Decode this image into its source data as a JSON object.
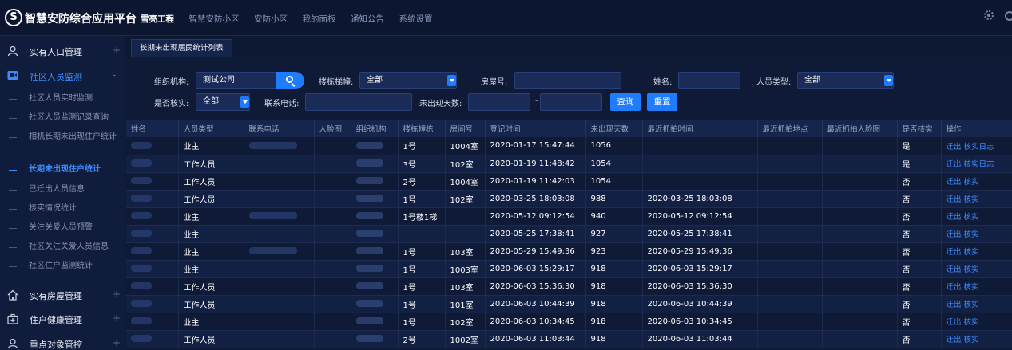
{
  "app": {
    "logo_glyph": "S",
    "title": "智慧安防综合应用平台"
  },
  "topnav": [
    "雪亮工程",
    "智慧安防小区",
    "安防小区",
    "我的面板",
    "通知公告",
    "系统设置"
  ],
  "sidebar": {
    "groups": [
      {
        "label": "实有人口管理",
        "toggle": "+",
        "icon": "person-icon"
      },
      {
        "label": "社区人员监测",
        "toggle": "-",
        "icon": "monitor-icon"
      },
      {
        "label": "实有房屋管理",
        "toggle": "+",
        "icon": "house-icon"
      },
      {
        "label": "住户健康管理",
        "toggle": "+",
        "icon": "medical-kit-icon"
      },
      {
        "label": "重点对象管控",
        "toggle": "+",
        "icon": "person-icon"
      }
    ],
    "items": [
      "社区人员实时监测",
      "社区人员监测记录查询",
      "相机长期未出现住户统计",
      "长期未出现住户统计",
      "已迁出人员信息",
      "核实情况统计",
      "关注关爱人员预警",
      "社区关注关爱人员信息",
      "社区住户监测统计"
    ]
  },
  "tab": {
    "label": "长期未出现居民统计列表"
  },
  "filters": {
    "org_label": "组织机构:",
    "org_value": "测试公司",
    "building_label": "楼栋梯幢:",
    "building_value": "全部",
    "room_label": "房屋号:",
    "name_label": "姓名:",
    "person_type_label": "人员类型:",
    "person_type_value": "全部",
    "verified_label": "是否核实:",
    "verified_value": "全部",
    "phone_label": "联系电话:",
    "days_label": "未出现天数:",
    "range_sep": "-",
    "query_button": "查询",
    "reset_button": "重置"
  },
  "table": {
    "columns": [
      "姓名",
      "人员类型",
      "联系电话",
      "人脸图",
      "组织机构",
      "楼栋幢栋",
      "房间号",
      "登记时间",
      "未出现天数",
      "最近抓拍时间",
      "最近抓拍地点",
      "最近抓拍人脸图",
      "是否核实",
      "操作"
    ],
    "rows": [
      {
        "type": "业主",
        "building": "1号",
        "room": "1004室",
        "reg_time": "2020-01-17 15:47:44",
        "days": "1056",
        "last_time": "",
        "verified": "是",
        "ops": "迁出 核实日志"
      },
      {
        "type": "工作人员",
        "building": "3号",
        "room": "102室",
        "reg_time": "2020-01-19 11:48:42",
        "days": "1054",
        "last_time": "",
        "verified": "是",
        "ops": "迁出 核实日志"
      },
      {
        "type": "工作人员",
        "building": "2号",
        "room": "1004室",
        "reg_time": "2020-01-19 11:42:03",
        "days": "1054",
        "last_time": "",
        "verified": "否",
        "ops": "迁出 核实"
      },
      {
        "type": "工作人员",
        "building": "1号",
        "room": "102室",
        "reg_time": "2020-03-25 18:03:08",
        "days": "988",
        "last_time": "2020-03-25 18:03:08",
        "verified": "否",
        "ops": "迁出 核实"
      },
      {
        "type": "业主",
        "building": "1号楼1梯",
        "room": "",
        "reg_time": "2020-05-12 09:12:54",
        "days": "940",
        "last_time": "2020-05-12 09:12:54",
        "verified": "否",
        "ops": "迁出 核实"
      },
      {
        "type": "业主",
        "building": "",
        "room": "",
        "reg_time": "2020-05-25 17:38:41",
        "days": "927",
        "last_time": "2020-05-25 17:38:41",
        "verified": "否",
        "ops": "迁出 核实"
      },
      {
        "type": "业主",
        "building": "1号",
        "room": "103室",
        "reg_time": "2020-05-29 15:49:36",
        "days": "923",
        "last_time": "2020-05-29 15:49:36",
        "verified": "否",
        "ops": "迁出 核实"
      },
      {
        "type": "业主",
        "building": "1号",
        "room": "1003室",
        "reg_time": "2020-06-03 15:29:17",
        "days": "918",
        "last_time": "2020-06-03 15:29:17",
        "verified": "否",
        "ops": "迁出 核实"
      },
      {
        "type": "工作人员",
        "building": "1号",
        "room": "103室",
        "reg_time": "2020-06-03 15:36:30",
        "days": "918",
        "last_time": "2020-06-03 15:36:30",
        "verified": "否",
        "ops": "迁出 核实"
      },
      {
        "type": "工作人员",
        "building": "1号",
        "room": "101室",
        "reg_time": "2020-06-03 10:44:39",
        "days": "918",
        "last_time": "2020-06-03 10:44:39",
        "verified": "否",
        "ops": "迁出 核实"
      },
      {
        "type": "业主",
        "building": "1号",
        "room": "102室",
        "reg_time": "2020-06-03 10:34:45",
        "days": "918",
        "last_time": "2020-06-03 10:34:45",
        "verified": "否",
        "ops": "迁出 核实"
      },
      {
        "type": "工作人员",
        "building": "2号",
        "room": "1002室",
        "reg_time": "2020-06-03 11:03:44",
        "days": "918",
        "last_time": "2020-06-03 11:03:44",
        "verified": "否",
        "ops": "迁出 核实"
      }
    ]
  }
}
